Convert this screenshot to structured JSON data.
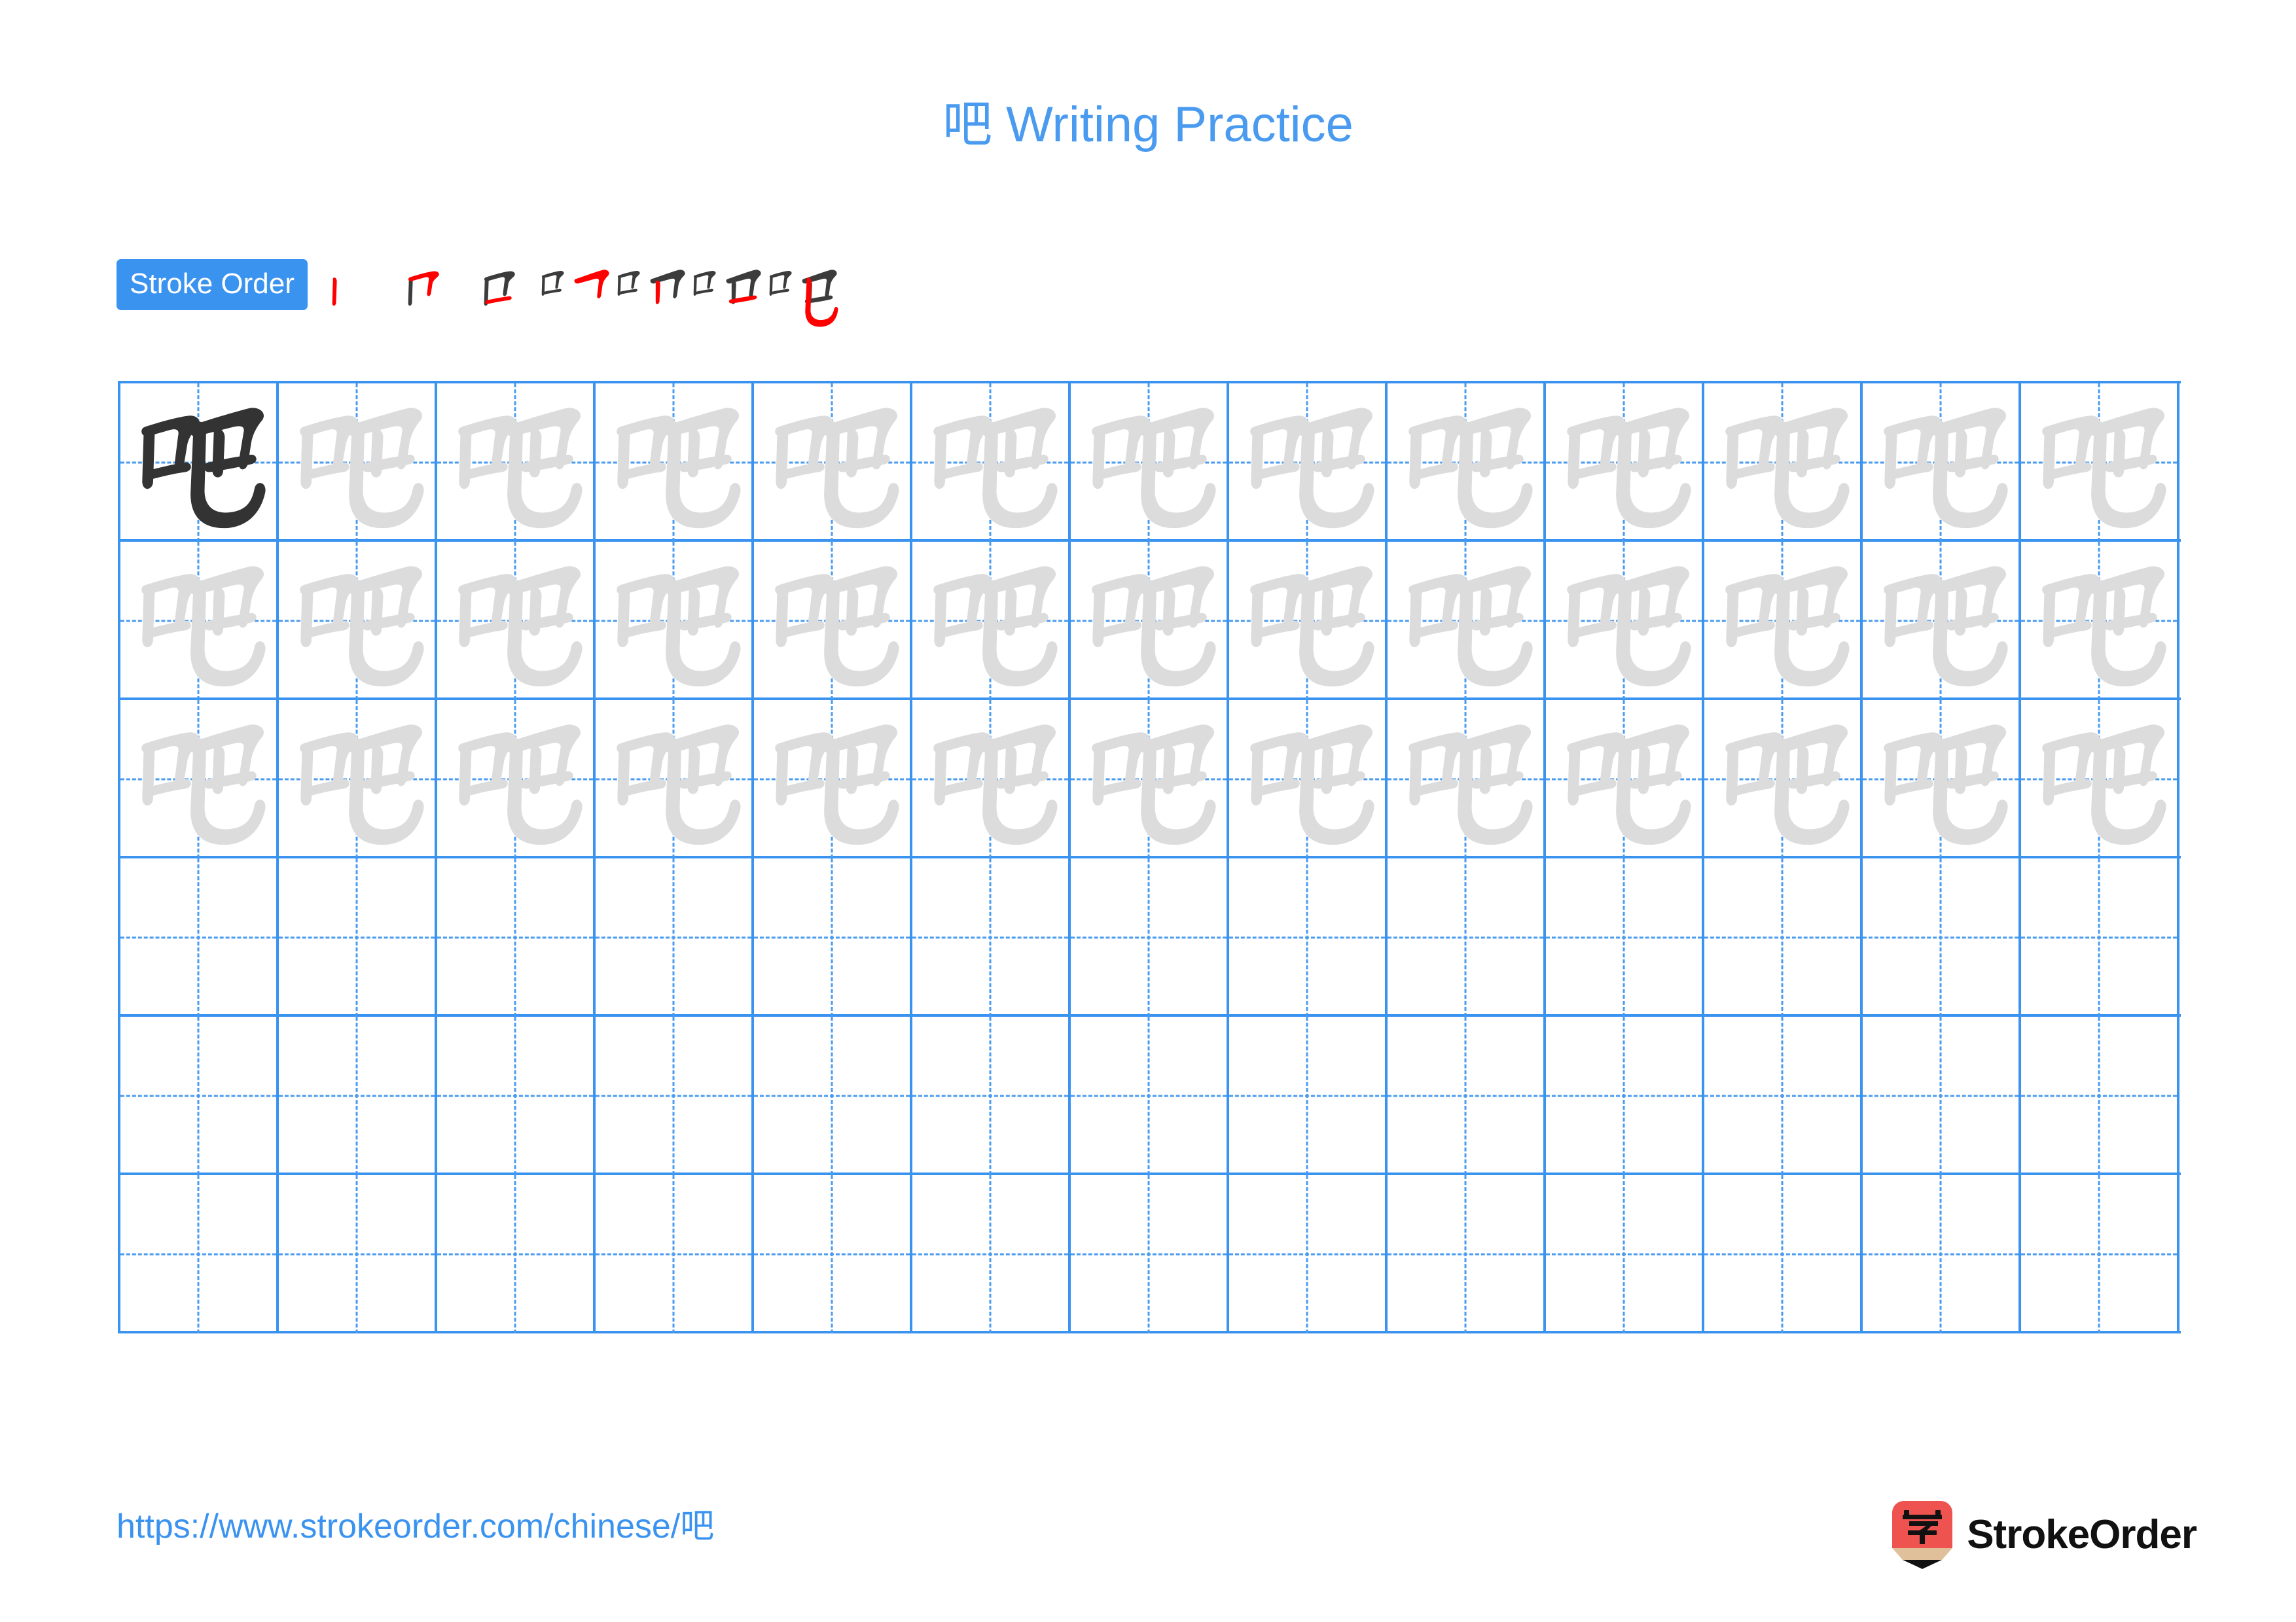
{
  "page": {
    "character": "吧",
    "title": "吧 Writing Practice",
    "title_prefix": "吧",
    "title_suffix": " Writing Practice",
    "background_color": "#FFFFFF",
    "accent_color": "#3B93F0",
    "trace_color": "#DCDCDC",
    "ink_color": "#333333",
    "highlight_stroke_color": "#FF0000"
  },
  "stroke_order": {
    "badge_label": "Stroke Order",
    "stroke_count": 7,
    "steps": [
      {
        "index": 1,
        "name": "stroke-step-1",
        "new_stroke": "shu",
        "strokes_shown": 1
      },
      {
        "index": 2,
        "name": "stroke-step-2",
        "new_stroke": "heng-zhe",
        "strokes_shown": 2
      },
      {
        "index": 3,
        "name": "stroke-step-3",
        "new_stroke": "heng",
        "strokes_shown": 3
      },
      {
        "index": 4,
        "name": "stroke-step-4",
        "new_stroke": "heng-zhe",
        "strokes_shown": 4
      },
      {
        "index": 5,
        "name": "stroke-step-5",
        "new_stroke": "shu",
        "strokes_shown": 5
      },
      {
        "index": 6,
        "name": "stroke-step-6",
        "new_stroke": "heng",
        "strokes_shown": 6
      },
      {
        "index": 7,
        "name": "stroke-step-7",
        "new_stroke": "shu-wan-gou",
        "strokes_shown": 7
      }
    ]
  },
  "practice_grid": {
    "columns": 13,
    "rows": 6,
    "cell_size_px": 242,
    "rows_data": [
      {
        "row": 1,
        "cells": [
          "ink",
          "trace",
          "trace",
          "trace",
          "trace",
          "trace",
          "trace",
          "trace",
          "trace",
          "trace",
          "trace",
          "trace",
          "trace"
        ]
      },
      {
        "row": 2,
        "cells": [
          "trace",
          "trace",
          "trace",
          "trace",
          "trace",
          "trace",
          "trace",
          "trace",
          "trace",
          "trace",
          "trace",
          "trace",
          "trace"
        ]
      },
      {
        "row": 3,
        "cells": [
          "trace",
          "trace",
          "trace",
          "trace",
          "trace",
          "trace",
          "trace",
          "trace",
          "trace",
          "trace",
          "trace",
          "trace",
          "trace"
        ]
      },
      {
        "row": 4,
        "cells": [
          "empty",
          "empty",
          "empty",
          "empty",
          "empty",
          "empty",
          "empty",
          "empty",
          "empty",
          "empty",
          "empty",
          "empty",
          "empty"
        ]
      },
      {
        "row": 5,
        "cells": [
          "empty",
          "empty",
          "empty",
          "empty",
          "empty",
          "empty",
          "empty",
          "empty",
          "empty",
          "empty",
          "empty",
          "empty",
          "empty"
        ]
      },
      {
        "row": 6,
        "cells": [
          "empty",
          "empty",
          "empty",
          "empty",
          "empty",
          "empty",
          "empty",
          "empty",
          "empty",
          "empty",
          "empty",
          "empty",
          "empty"
        ]
      }
    ]
  },
  "footer": {
    "url_text": "https://www.strokeorder.com/chinese/吧",
    "url_prefix": "https://www.strokeorder.com/chinese/",
    "url_character": "吧",
    "brand_name": "StrokeOrder",
    "brand_mark_character": "字",
    "brand_mark_body_color": "#EE5350",
    "brand_mark_wood_color": "#E0C09B",
    "brand_mark_tip_color": "#111111"
  }
}
